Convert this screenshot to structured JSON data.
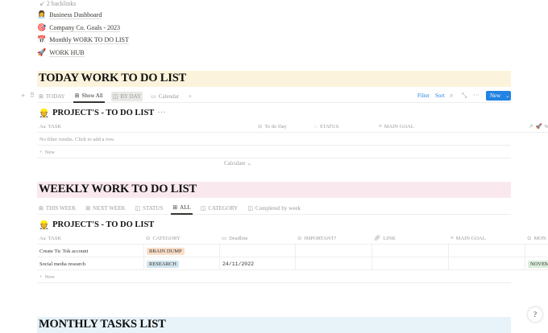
{
  "backlinks": "2 backlinks",
  "links": [
    {
      "icon": "👩‍💼",
      "label": "Business Dashboard"
    },
    {
      "icon": "🎯",
      "label": "Company Co. Goals - 2023"
    },
    {
      "icon": "📅",
      "label": "Monthly WORK TO DO LIST"
    },
    {
      "icon": "🚀",
      "label": "WORK HUB"
    }
  ],
  "today": {
    "heading": "TODAY WORK TO DO LIST",
    "heading_bg": "#fbf3db",
    "tabs": [
      "TODAY",
      "Show All",
      "BY DAY",
      "Calendar"
    ],
    "toolbar": {
      "filter": "Filter",
      "sort": "Sort",
      "new": "New"
    },
    "db_title": "PROJECT'S - TO DO LIST",
    "columns": [
      "TASK",
      "To do Day",
      "STATUS",
      "MAIN GOAL",
      "W"
    ],
    "empty": "No filter results. Click to add a row.",
    "new_row": "New",
    "calculate": "Calculate"
  },
  "weekly": {
    "heading": "WEEKLY WORK TO DO LIST",
    "heading_bg": "#f9e9ef",
    "tabs": [
      "THIS WEEK",
      "NEXT WEEK",
      "STATUS",
      "ALL",
      "CATEGORY",
      "Completed by week"
    ],
    "db_title": "PROJECT'S - TO DO LIST",
    "columns": [
      "TASK",
      "CATEGORY",
      "Deadline",
      "IMPORTANT?",
      "LINK",
      "MAIN GOAL",
      "MON"
    ],
    "rows": [
      {
        "task": "Create Tic Tok account",
        "category": "BRAIN DUMP",
        "deadline": "",
        "month": ""
      },
      {
        "task": "Social media research",
        "category": "RESEARCH",
        "deadline": "24/11/2022",
        "month": "NOVEM"
      }
    ],
    "tag_colors": {
      "BRAIN DUMP": "#fadec9",
      "RESEARCH": "#d3e5ef",
      "NOVEM": "#dbeddb"
    },
    "new_row": "New"
  },
  "monthly": {
    "heading": "MONTHLY TASKS LIST",
    "heading_bg": "#e7f3f8"
  },
  "help": "?"
}
